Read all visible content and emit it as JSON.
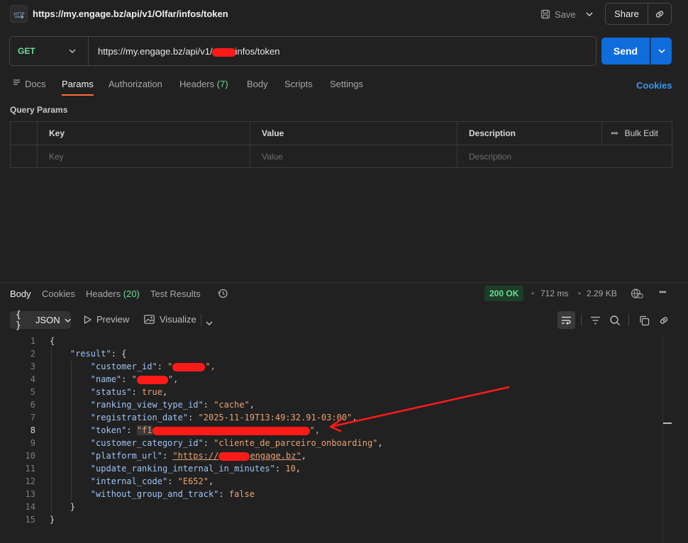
{
  "window": {
    "title_url": "https://my.engage.bz/api/v1/Olfar/infos/token",
    "save_label": "Save",
    "share_label": "Share"
  },
  "request": {
    "method": "GET",
    "url_prefix": "https://my.engage.bz/api/v1/",
    "url_suffix": "infos/token",
    "send_label": "Send"
  },
  "request_tabs": {
    "docs": "Docs",
    "params": "Params",
    "authorization": "Authorization",
    "headers": "Headers",
    "headers_count": "(7)",
    "body": "Body",
    "scripts": "Scripts",
    "settings": "Settings",
    "cookies": "Cookies"
  },
  "query_params": {
    "title": "Query Params",
    "columns": {
      "key": "Key",
      "value": "Value",
      "description": "Description",
      "bulk_edit": "Bulk Edit"
    },
    "placeholders": {
      "key": "Key",
      "value": "Value",
      "description": "Description"
    }
  },
  "response_tabs": {
    "body": "Body",
    "cookies": "Cookies",
    "headers": "Headers",
    "headers_count": "(20)",
    "test_results": "Test Results"
  },
  "response_meta": {
    "status": "200 OK",
    "time": "712 ms",
    "size": "2.29 KB"
  },
  "response_toolbar": {
    "format": "JSON",
    "preview": "Preview",
    "visualize": "Visualize"
  },
  "response_body": {
    "line_numbers": [
      "1",
      "2",
      "3",
      "4",
      "5",
      "6",
      "7",
      "8",
      "9",
      "10",
      "11",
      "12",
      "13",
      "14",
      "15"
    ],
    "open_brace": "{",
    "result_key": "\"result\"",
    "customer_id_key": "\"customer_id\"",
    "customer_id_val_start": "\"",
    "customer_id_val_end": "\",",
    "name_key": "\"name\"",
    "name_val_start": "\"",
    "name_val_end": "\",",
    "status_key": "\"status\"",
    "status_val": "true",
    "ranking_key": "\"ranking_view_type_id\"",
    "ranking_val": "\"cache\"",
    "registration_key": "\"registration_date\"",
    "registration_val": "\"2025-11-19T13:49:32.91-03:00\"",
    "token_key": "\"token\"",
    "token_val_start": "\"f1",
    "token_val_end": "\",",
    "category_key": "\"customer_category_id\"",
    "category_val": "\"cliente_de_parceiro_onboarding\"",
    "platform_key": "\"platform_url\"",
    "platform_val_start": "\"https://",
    "platform_val_end": "engage.bz\"",
    "update_key": "\"update_ranking_internal_in_minutes\"",
    "update_val": "10",
    "internal_key": "\"internal_code\"",
    "internal_val": "\"E652\"",
    "without_key": "\"without_group_and_track\"",
    "without_val": "false",
    "close_inner": "}",
    "close_outer": "}"
  },
  "colors": {
    "accent_orange": "#ff6c37",
    "send_blue": "#0f6ddb",
    "status_green": "#6bdd9a",
    "redaction_red": "#ff1a1a"
  }
}
